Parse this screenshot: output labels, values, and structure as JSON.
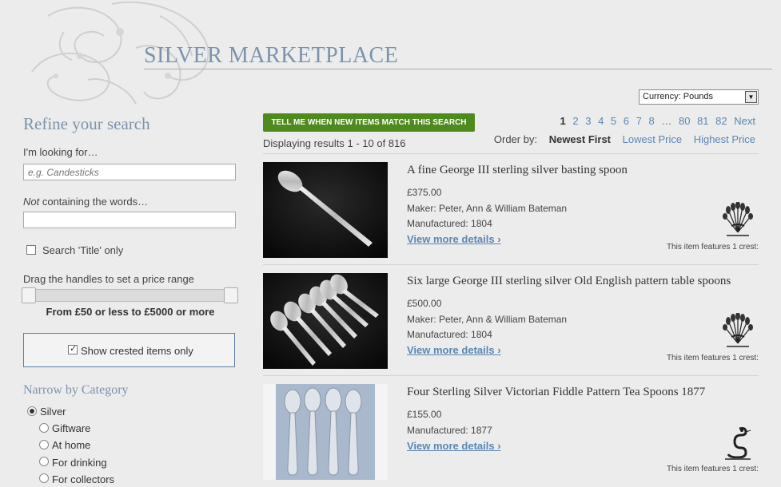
{
  "header": {
    "title": "SILVER MARKETPLACE"
  },
  "currency": {
    "label": "Currency: Pounds"
  },
  "sidebar": {
    "refine_title": "Refine your search",
    "looking_for_label": "I'm looking for…",
    "looking_for_placeholder": "e.g. Candesticks",
    "not_containing_emph": "Not",
    "not_containing_rest": " containing the words…",
    "title_only_label": "Search 'Title' only",
    "price_instructions": "Drag the handles to set a price range",
    "price_range": "From £50 or less to £5000 or more",
    "crested_label": "Show crested items only",
    "crested_checked": true,
    "narrow_title": "Narrow by Category",
    "categories": [
      {
        "label": "Silver",
        "selected": true
      },
      {
        "label": "Giftware",
        "selected": false
      },
      {
        "label": "At home",
        "selected": false
      },
      {
        "label": "For drinking",
        "selected": false
      },
      {
        "label": "For collectors",
        "selected": false
      }
    ]
  },
  "main": {
    "alert_button": "TELL ME WHEN NEW ITEMS MATCH THIS SEARCH",
    "results_count": "Displaying results 1 - 10 of 816",
    "pagination": [
      "1",
      "2",
      "3",
      "4",
      "5",
      "6",
      "7",
      "8",
      "…",
      "80",
      "81",
      "82",
      "Next"
    ],
    "current_page": "1",
    "order_label": "Order by:",
    "order_options": [
      "Newest First",
      "Lowest Price",
      "Highest Price"
    ],
    "active_order": "Newest First",
    "items": [
      {
        "title": "A fine George III sterling silver basting spoon",
        "price": "£375.00",
        "maker": "Maker: Peter, Ann & William Bateman",
        "manufactured": "Manufactured: 1804",
        "link": "View more details ›",
        "crest_note": "This item features 1 crest:"
      },
      {
        "title": "Six large George III sterling silver Old English pattern table spoons",
        "price": "£500.00",
        "maker": "Maker: Peter, Ann & William Bateman",
        "manufactured": "Manufactured: 1804",
        "link": "View more details ›",
        "crest_note": "This item features 1 crest:"
      },
      {
        "title": "Four Sterling Silver Victorian Fiddle Pattern Tea Spoons 1877",
        "price": "£155.00",
        "manufactured": "Manufactured: 1877",
        "link": "View more details ›",
        "crest_note": "This item features 1 crest:"
      }
    ]
  },
  "colors": {
    "accent_blue": "#5b86b5",
    "title_blue": "#7d93ad",
    "alert_green": "#4f8a1f"
  }
}
